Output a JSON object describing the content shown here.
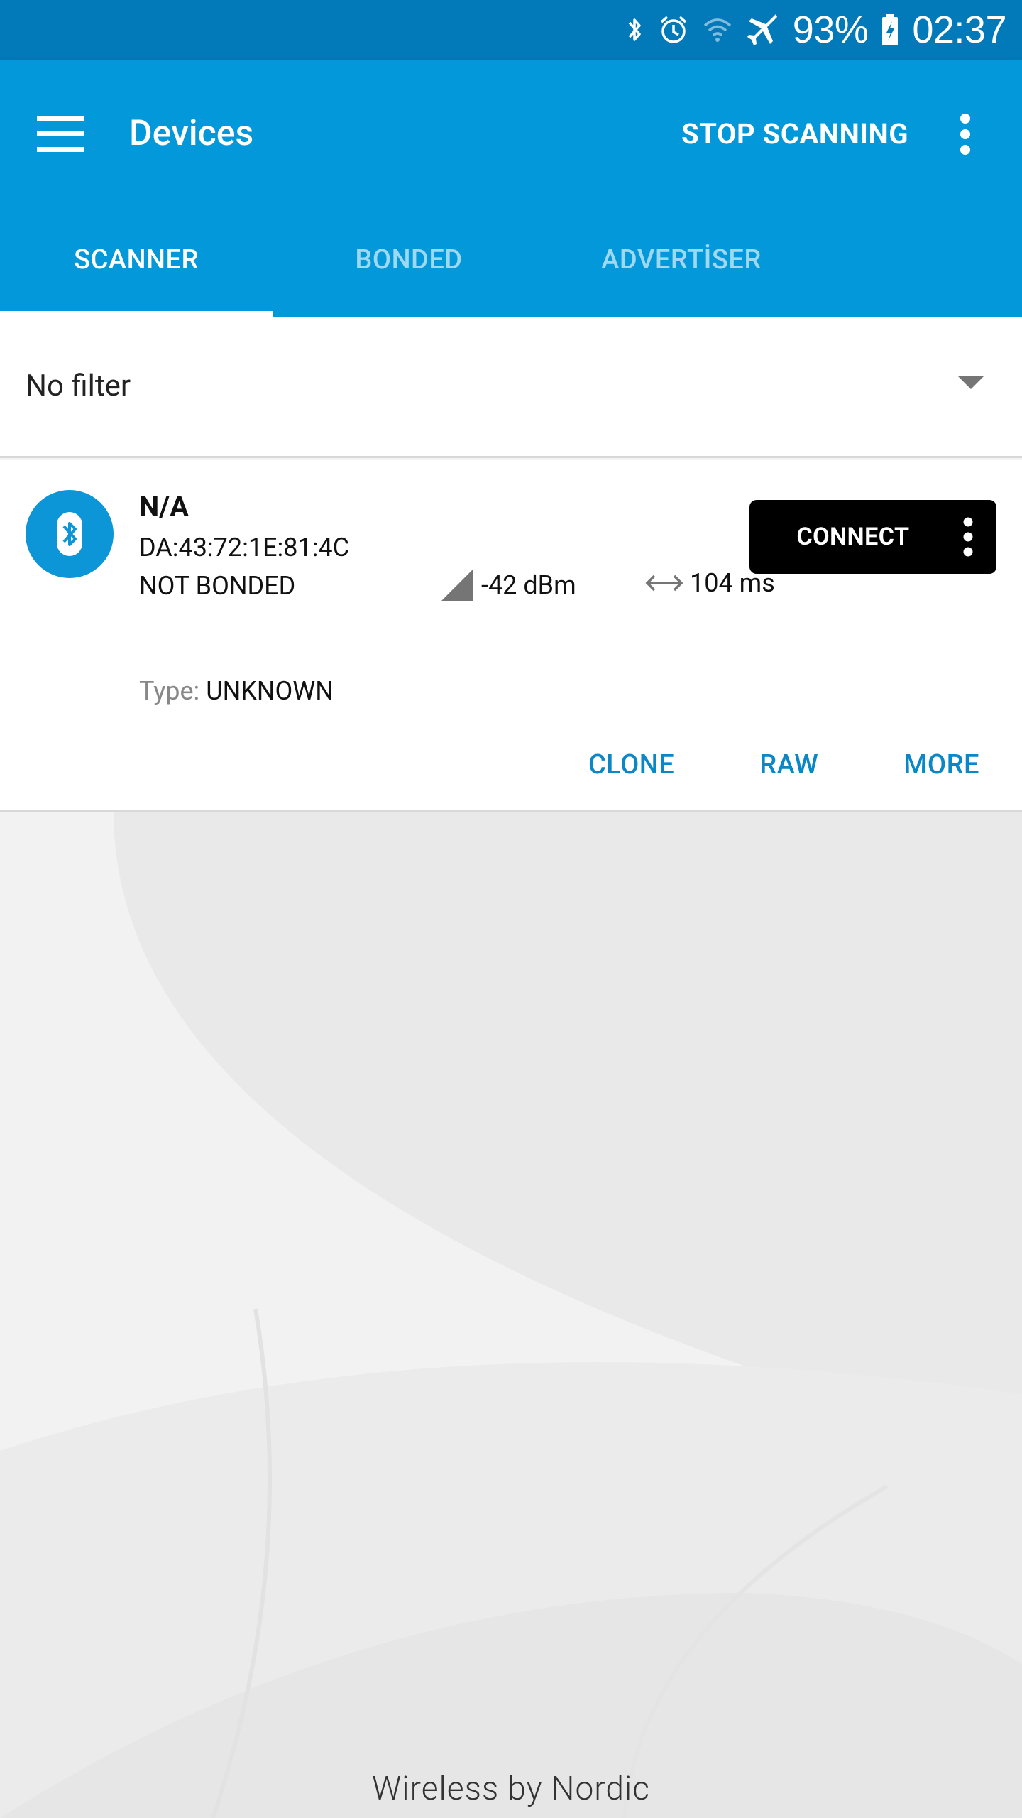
{
  "status_bar": {
    "battery_percent": "93%",
    "time": "02:37",
    "icons": [
      "bluetooth-icon",
      "alarm-icon",
      "wifi-icon",
      "airplane-mode-icon",
      "battery-icon"
    ]
  },
  "app_bar": {
    "title": "Devices",
    "stop_scanning_label": "STOP SCANNING",
    "tabs": [
      {
        "label": "SCANNER",
        "active": true
      },
      {
        "label": "BONDED",
        "active": false
      },
      {
        "label": "ADVERTİSER",
        "active": false
      }
    ]
  },
  "filter": {
    "label": "No filter"
  },
  "devices": [
    {
      "name": "N/A",
      "address": "DA:43:72:1E:81:4C",
      "bond_state": "NOT BONDED",
      "rssi": "-42 dBm",
      "interval": "104 ms",
      "connect_label": "CONNECT",
      "type_label": "Type:",
      "type_value": "UNKNOWN",
      "actions": [
        "CLONE",
        "RAW",
        "MORE"
      ]
    }
  ],
  "footer": {
    "brand": "Wireless by Nordic"
  },
  "colors": {
    "status_bar": "#0279b9",
    "app_bar": "#0398da",
    "accent_text": "#0a87c7",
    "connect_bg": "#000000"
  }
}
